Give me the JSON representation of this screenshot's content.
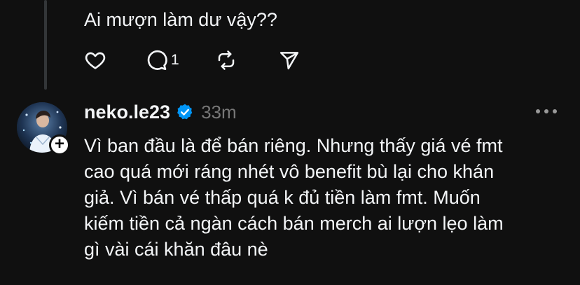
{
  "previous_post": {
    "text": "Ai mượn làm dư vậy??",
    "actions": {
      "like_icon": "heart-icon",
      "reply_icon": "comment-icon",
      "reply_count": "1",
      "repost_icon": "repost-icon",
      "share_icon": "send-icon"
    }
  },
  "reply_post": {
    "username": "neko.le23",
    "verified_icon": "verified-badge-icon",
    "time": "33m",
    "more_icon": "more-horizontal-icon",
    "follow_icon": "plus-icon",
    "body_lines": [
      "Vì ban đầu là để bán riêng. Nhưng thấy giá vé fmt",
      "cao quá mới ráng nhét vô benefit bù lại cho khán",
      "giả. Vì bán vé thấp quá k đủ tiền làm fmt. Muốn",
      "kiếm tiền cả ngàn cách bán merch ai lượn lẹo làm",
      "gì vài cái khăn đâu nè"
    ]
  },
  "colors": {
    "background": "#101010",
    "text": "#f3f5f7",
    "muted": "#777777",
    "verified": "#0095f6",
    "thread_line": "#333638"
  }
}
